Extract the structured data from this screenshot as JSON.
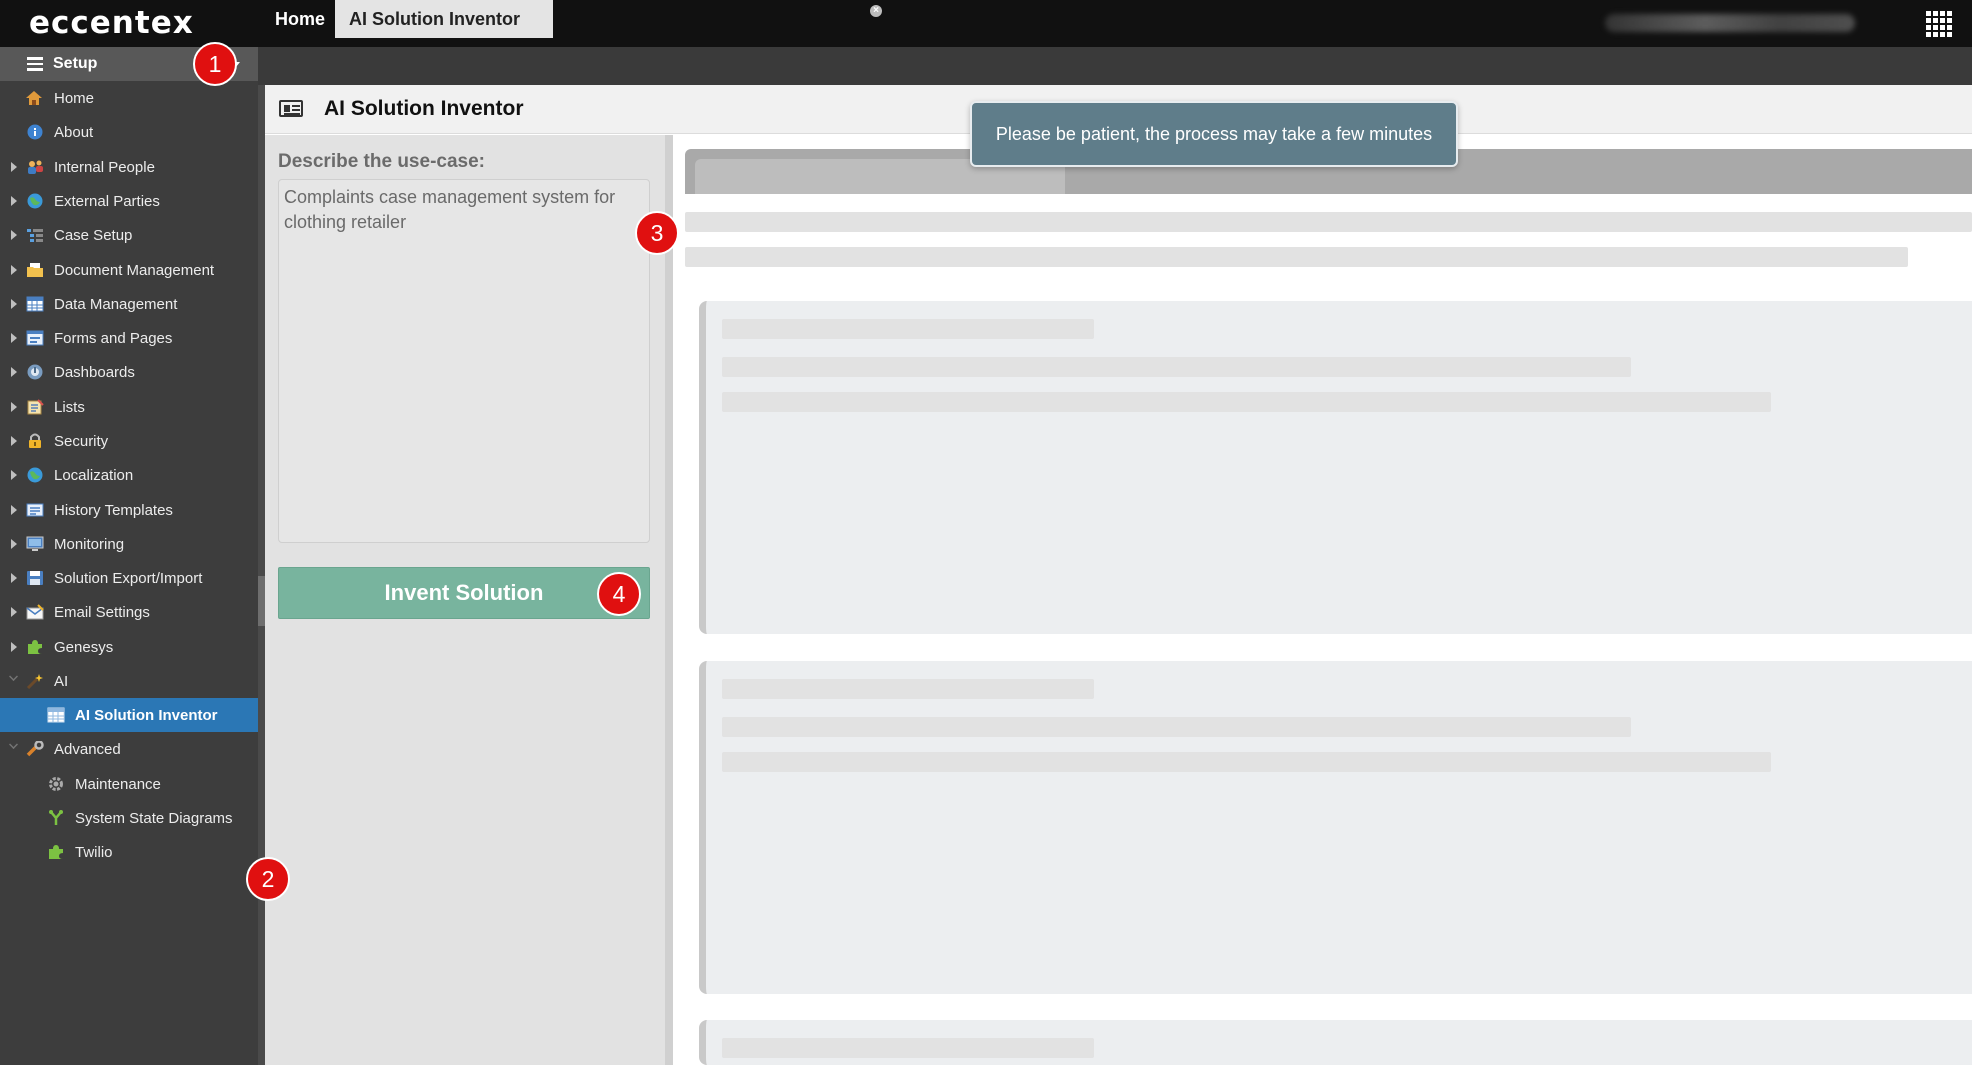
{
  "app": {
    "logo": "eccentex"
  },
  "sidebar": {
    "header": {
      "title": "Setup"
    },
    "items": [
      {
        "label": "Home",
        "icon": "home-icon",
        "expandable": false
      },
      {
        "label": "About",
        "icon": "info-icon",
        "expandable": false
      },
      {
        "label": "Internal People",
        "icon": "people-icon",
        "expandable": true
      },
      {
        "label": "External Parties",
        "icon": "globe-icon",
        "expandable": true
      },
      {
        "label": "Case Setup",
        "icon": "case-setup-icon",
        "expandable": true
      },
      {
        "label": "Document Management",
        "icon": "folder-icon",
        "expandable": true
      },
      {
        "label": "Data Management",
        "icon": "table-icon",
        "expandable": true
      },
      {
        "label": "Forms and Pages",
        "icon": "form-icon",
        "expandable": true
      },
      {
        "label": "Dashboards",
        "icon": "dashboard-icon",
        "expandable": true
      },
      {
        "label": "Lists",
        "icon": "list-icon",
        "expandable": true
      },
      {
        "label": "Security",
        "icon": "lock-icon",
        "expandable": true
      },
      {
        "label": "Localization",
        "icon": "globe-icon",
        "expandable": true
      },
      {
        "label": "History Templates",
        "icon": "history-icon",
        "expandable": true
      },
      {
        "label": "Monitoring",
        "icon": "monitor-icon",
        "expandable": true
      },
      {
        "label": "Solution Export/Import",
        "icon": "save-icon",
        "expandable": true
      },
      {
        "label": "Email Settings",
        "icon": "email-icon",
        "expandable": true
      },
      {
        "label": "Genesys",
        "icon": "puzzle-icon",
        "expandable": true
      },
      {
        "label": "AI",
        "icon": "magic-wand-icon",
        "expanded": true
      },
      {
        "label": "AI Solution Inventor",
        "icon": "table-icon",
        "child": true,
        "active": true
      },
      {
        "label": "Advanced",
        "icon": "wrench-icon",
        "expanded": true
      },
      {
        "label": "Maintenance",
        "icon": "gear-icon",
        "child": true
      },
      {
        "label": "System State Diagrams",
        "icon": "branch-icon",
        "child": true
      },
      {
        "label": "Twilio",
        "icon": "puzzle-icon",
        "child": true
      }
    ]
  },
  "tabs": [
    {
      "label": "Home"
    },
    {
      "label": "AI Solution Inventor",
      "active": true,
      "close_icon": "close-icon"
    }
  ],
  "page": {
    "title": "AI Solution Inventor",
    "usecase_label": "Describe the use-case:",
    "usecase_value": "Complaints case management system for clothing retailer",
    "invent_button": "Invent Solution",
    "toast": "Please be patient, the process may take a few minutes"
  },
  "annotations": [
    "1",
    "2",
    "3",
    "4"
  ],
  "colors": {
    "topbar": "#111111",
    "sidebar": "#3d3d3d",
    "active_item": "#2b77b5",
    "invent_button": "#78b49e",
    "toast": "#5f7d8a",
    "annotation_badge": "#e01010"
  }
}
